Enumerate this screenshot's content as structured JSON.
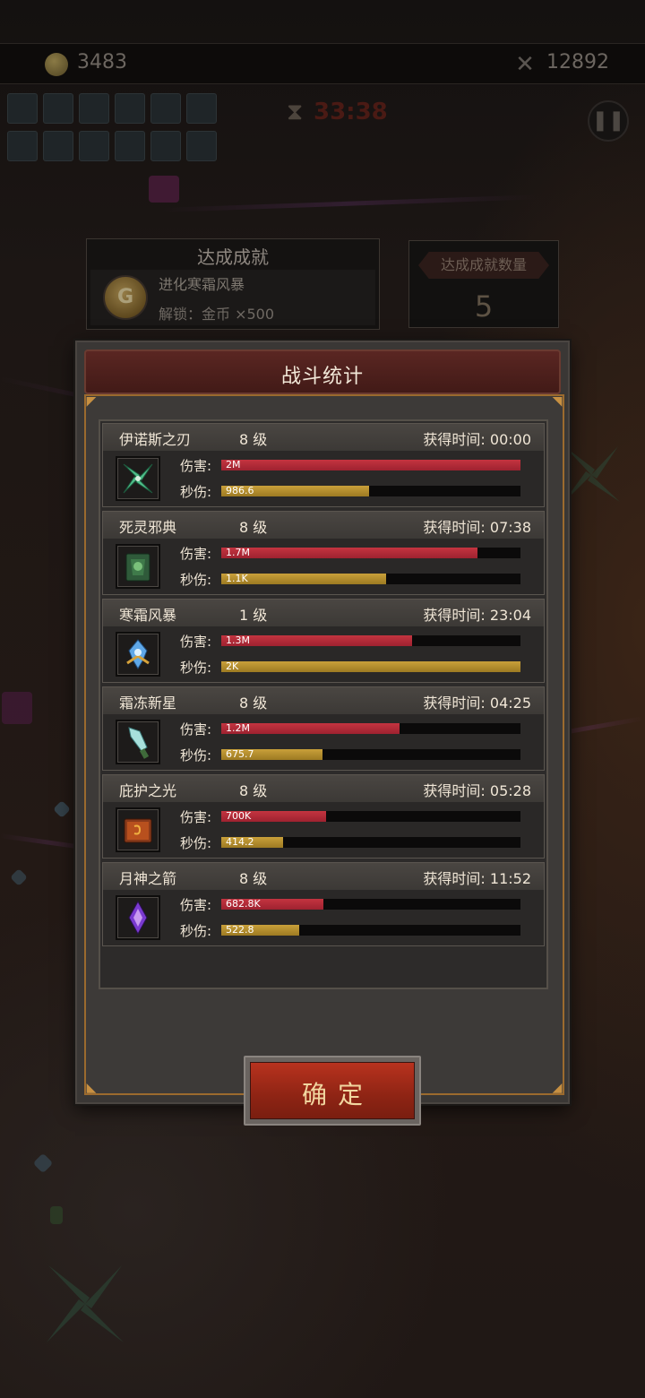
{
  "hud": {
    "gold": "3483",
    "kills": "12892",
    "timer": "33:38"
  },
  "achievement": {
    "title": "达成成就",
    "name": "进化寒霜风暴",
    "unlock": "解锁：金币 ×500",
    "coin_letter": "G",
    "count_label": "达成成就数量",
    "count": "5"
  },
  "dialog": {
    "title": "战斗统计",
    "damage_label": "伤害:",
    "dps_label": "秒伤:",
    "time_prefix": "获得时间:",
    "confirm_label": "确定",
    "rows": [
      {
        "name": "伊诺斯之刃",
        "level": "8 级",
        "time": "获得时间: 00:00",
        "damage": "2M",
        "dps": "986.6",
        "damage_frac": 1.0,
        "dps_frac": 0.493,
        "icon": "shuriken-icon"
      },
      {
        "name": "死灵邪典",
        "level": "8 级",
        "time": "获得时间: 07:38",
        "damage": "1.7M",
        "dps": "1.1K",
        "damage_frac": 0.855,
        "dps_frac": 0.55,
        "icon": "necro-book-icon"
      },
      {
        "name": "寒霜风暴",
        "level": "1 级",
        "time": "获得时间: 23:04",
        "damage": "1.3M",
        "dps": "2K",
        "damage_frac": 0.638,
        "dps_frac": 1.0,
        "icon": "frost-storm-icon"
      },
      {
        "name": "霜冻新星",
        "level": "8 级",
        "time": "获得时间: 04:25",
        "damage": "1.2M",
        "dps": "675.7",
        "damage_frac": 0.595,
        "dps_frac": 0.338,
        "icon": "frost-sword-icon"
      },
      {
        "name": "庇护之光",
        "level": "8 级",
        "time": "获得时间: 05:28",
        "damage": "700K",
        "dps": "414.2",
        "damage_frac": 0.35,
        "dps_frac": 0.207,
        "icon": "holy-book-icon"
      },
      {
        "name": "月神之箭",
        "level": "8 级",
        "time": "获得时间: 11:52",
        "damage": "682.8K",
        "dps": "522.8",
        "damage_frac": 0.341,
        "dps_frac": 0.261,
        "icon": "moon-arrow-icon"
      }
    ]
  },
  "colors": {
    "damage_bar": "#c43440",
    "dps_bar": "#c9a03a",
    "header": "#5a2622",
    "frame_gold": "#9b6a2e",
    "confirm": "#9e2818"
  }
}
